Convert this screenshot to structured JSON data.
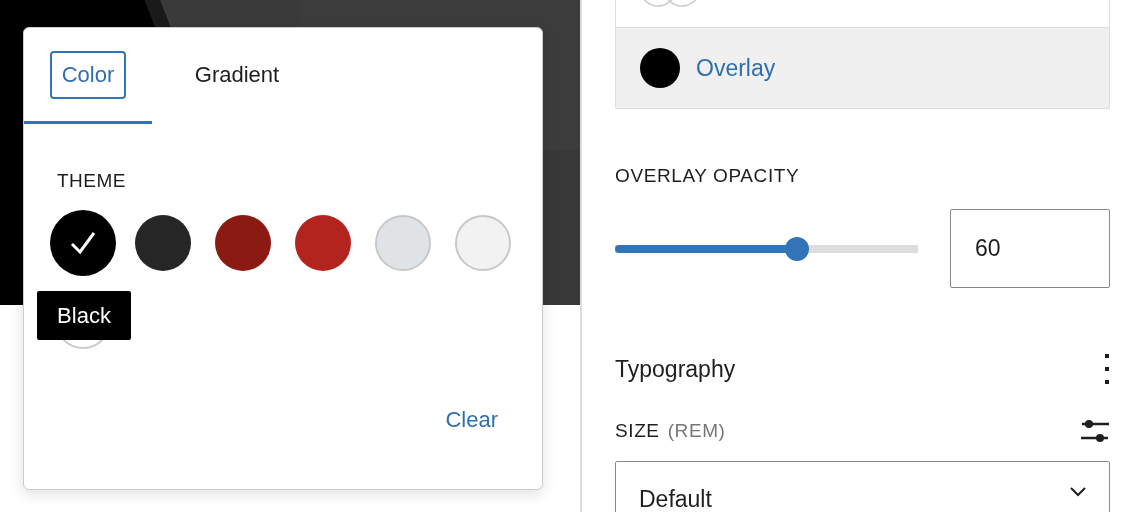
{
  "popover": {
    "tabs": [
      {
        "label": "Color",
        "selected": true
      },
      {
        "label": "Gradient",
        "selected": false
      }
    ],
    "section_label": "THEME",
    "swatches": [
      {
        "color": "#000000",
        "selected": true
      },
      {
        "color": "#262626",
        "selected": false
      },
      {
        "color": "#8b1a12",
        "selected": false
      },
      {
        "color": "#b2241d",
        "selected": false
      },
      {
        "color": "#e0e3e6",
        "selected": false
      },
      {
        "color": "#f2f2f2",
        "selected": false
      },
      {
        "color": "#ffffff",
        "selected": false
      }
    ],
    "tooltip": "Black",
    "clear_button": "Clear"
  },
  "sidebar": {
    "color_items": [
      {
        "label": "Overlay",
        "color": "#000000",
        "selected": true
      }
    ],
    "opacity": {
      "label": "OVERLAY OPACITY",
      "level": 0.6,
      "value": "60"
    },
    "typography": {
      "title": "Typography",
      "size_label": "SIZE",
      "size_unit": "(REM)",
      "size_value": "Default"
    }
  }
}
